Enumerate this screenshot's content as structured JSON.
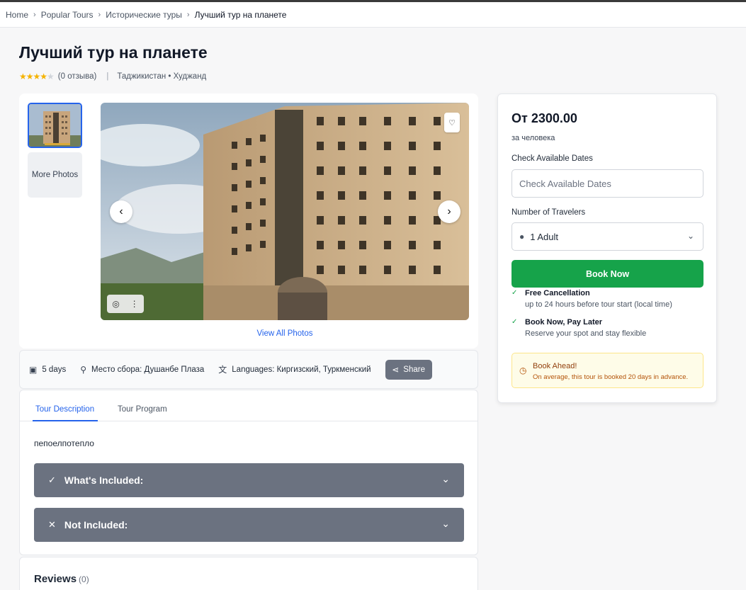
{
  "breadcrumb": {
    "items": [
      "Home",
      "Popular Tours",
      "Исторические туры"
    ],
    "current": "Лучший тур на планете",
    "separator": "›"
  },
  "tour": {
    "title": "Лучший тур на планете",
    "rating": 4.5,
    "reviews_text": "(0 отзыва)",
    "location": "Таджикистан • Худжанд"
  },
  "gallery": {
    "more_photos": "More Photos",
    "view_all": "View All Photos"
  },
  "info": {
    "duration": "5 days",
    "meeting_point": "Место сбора: Душанбе Плаза",
    "languages": "Languages: Киргизский, Туркменский",
    "share": "Share"
  },
  "tabs": [
    {
      "label": "Tour Description",
      "active": true
    },
    {
      "label": "Tour Program",
      "active": false
    }
  ],
  "description": "пепоелпотепло",
  "accordions": {
    "included": "What's Included:",
    "not_included": "Not Included:"
  },
  "reviews": {
    "title": "Reviews",
    "count": "(0)"
  },
  "booking": {
    "price": "От 2300.00",
    "per": "за человека",
    "dates_label": "Check Available Dates",
    "dates_placeholder": "Check Available Dates",
    "travelers_label": "Number of Travelers",
    "travelers_value": "1 Adult",
    "book_button": "Book Now",
    "perks": [
      {
        "title": "Free Cancellation",
        "sub": "up to 24 hours before tour start (local time)"
      },
      {
        "title": "Book Now, Pay Later",
        "sub": "Reserve your spot and stay flexible"
      }
    ],
    "ahead_title": "Book Ahead!",
    "ahead_text": "On average, this tour is booked 20 days in advance."
  },
  "colors": {
    "accent": "#2563eb",
    "book": "#16a34a",
    "accordion": "#6b7280",
    "star": "#f5b301"
  }
}
